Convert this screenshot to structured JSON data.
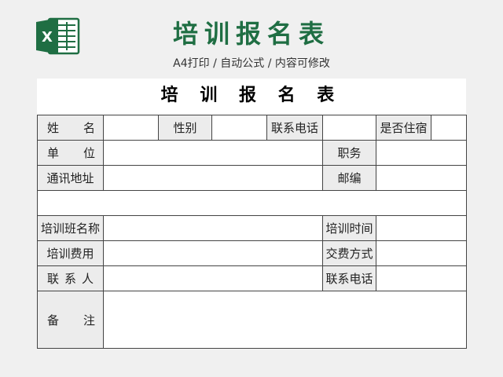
{
  "header": {
    "title": "培训报名表",
    "subtitle": "A4打印 / 自动公式 / 内容可修改"
  },
  "form": {
    "title": "培 训 报 名 表",
    "labels": {
      "name_a": "姓",
      "name_b": "名",
      "gender": "性别",
      "contact_phone": "联系电话",
      "lodging": "是否住宿",
      "unit_a": "单",
      "unit_b": "位",
      "position": "职务",
      "address": "通讯地址",
      "postcode": "邮编",
      "class_name": "培训班名称",
      "training_time": "培训时间",
      "training_fee": "培训费用",
      "payment_method": "交费方式",
      "contact_person_a": "联",
      "contact_person_b": "系",
      "contact_person_c": "人",
      "contact_phone2": "联系电话",
      "remarks_a": "备",
      "remarks_b": "注"
    }
  },
  "colors": {
    "brand_green": "#1f6e43",
    "label_bg": "#ececec"
  }
}
